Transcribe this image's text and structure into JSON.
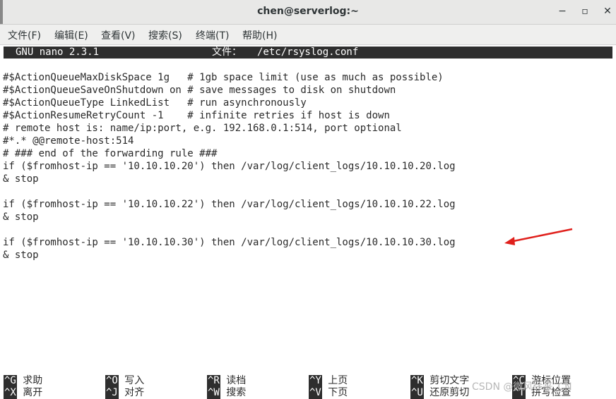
{
  "window": {
    "title": "chen@serverlog:~",
    "minimize_glyph": "−",
    "maximize_glyph": "▫",
    "close_glyph": "✕"
  },
  "menu": [
    {
      "label": "文件(F)"
    },
    {
      "label": "编辑(E)"
    },
    {
      "label": "查看(V)"
    },
    {
      "label": "搜索(S)"
    },
    {
      "label": "终端(T)"
    },
    {
      "label": "帮助(H)"
    }
  ],
  "nano": {
    "version": "GNU nano 2.3.1",
    "file_label": "文件：",
    "file_path": "/etc/rsyslog.conf"
  },
  "lines": [
    "#$ActionQueueMaxDiskSpace 1g   # 1gb space limit (use as much as possible)",
    "#$ActionQueueSaveOnShutdown on # save messages to disk on shutdown",
    "#$ActionQueueType LinkedList   # run asynchronously",
    "#$ActionResumeRetryCount -1    # infinite retries if host is down",
    "# remote host is: name/ip:port, e.g. 192.168.0.1:514, port optional",
    "#*.* @@remote-host:514",
    "# ### end of the forwarding rule ###",
    "if ($fromhost-ip == '10.10.10.20') then /var/log/client_logs/10.10.10.20.log",
    "& stop",
    "",
    "if ($fromhost-ip == '10.10.10.22') then /var/log/client_logs/10.10.10.22.log",
    "& stop",
    "",
    "if ($fromhost-ip == '10.10.10.30') then /var/log/client_logs/10.10.10.30.log",
    "& stop"
  ],
  "help": {
    "row1": [
      {
        "key": "^G",
        "label": "求助"
      },
      {
        "key": "^O",
        "label": "写入"
      },
      {
        "key": "^R",
        "label": "读档"
      },
      {
        "key": "^Y",
        "label": "上页"
      },
      {
        "key": "^K",
        "label": "剪切文字"
      },
      {
        "key": "^C",
        "label": "游标位置"
      }
    ],
    "row2": [
      {
        "key": "^X",
        "label": "离开"
      },
      {
        "key": "^J",
        "label": "对齐"
      },
      {
        "key": "^W",
        "label": "搜索"
      },
      {
        "key": "^V",
        "label": "下页"
      },
      {
        "key": "^U",
        "label": "还原剪切"
      },
      {
        "key": "^T",
        "label": "拼写检查"
      }
    ]
  },
  "watermark": "CSDN @微风徐来_CN",
  "colors": {
    "annotation_arrow": "#e0201c"
  }
}
